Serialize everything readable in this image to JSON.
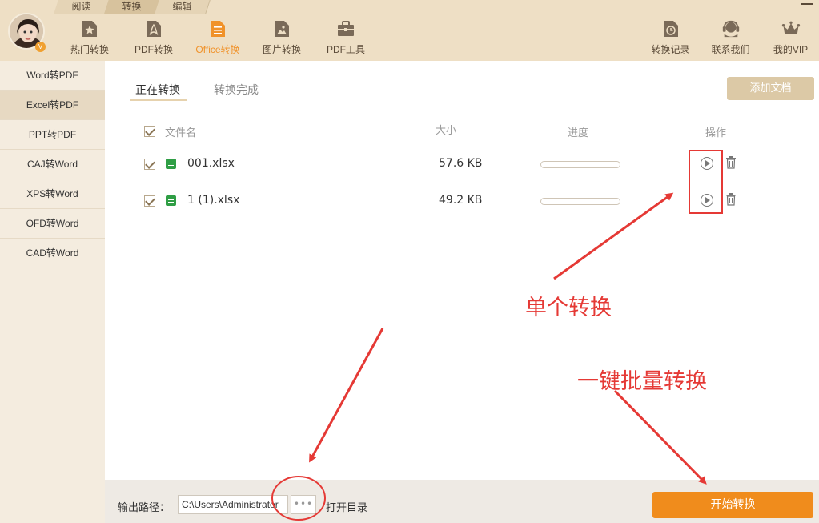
{
  "header": {
    "modes": [
      "阅读",
      "转换",
      "编辑"
    ],
    "active_mode": 1,
    "nav": [
      {
        "label": "热门转换",
        "icon": "star-doc-icon"
      },
      {
        "label": "PDF转换",
        "icon": "pdf-icon"
      },
      {
        "label": "Office转换",
        "icon": "office-doc-icon"
      },
      {
        "label": "图片转换",
        "icon": "image-icon"
      },
      {
        "label": "PDF工具",
        "icon": "toolbox-icon"
      }
    ],
    "active_nav": 2,
    "right_nav": [
      {
        "label": "转换记录",
        "icon": "clock-doc-icon"
      },
      {
        "label": "联系我们",
        "icon": "headset-icon"
      },
      {
        "label": "我的VIP",
        "icon": "crown-icon"
      }
    ],
    "avatar_badge": "V"
  },
  "sidebar": {
    "items": [
      "Word转PDF",
      "Excel转PDF",
      "PPT转PDF",
      "CAJ转Word",
      "XPS转Word",
      "OFD转Word",
      "CAD转Word"
    ],
    "active_index": 1
  },
  "main": {
    "tabs": [
      {
        "label": "正在转换"
      },
      {
        "label": "转换完成"
      }
    ],
    "add_button": "添加文档",
    "columns": {
      "name": "文件名",
      "size": "大小",
      "progress": "进度",
      "action": "操作"
    },
    "files": [
      {
        "name": "001.xlsx",
        "size": "57.6 KB",
        "progress": 0
      },
      {
        "name": "1 (1).xlsx",
        "size": "49.2 KB",
        "progress": 0
      }
    ]
  },
  "bottom": {
    "output_label": "输出路径：",
    "path": "C:\\Users\\Administrator",
    "browse_label": "•••",
    "open_dir": "打开目录",
    "start_button": "开始转换"
  },
  "annotations": {
    "single": "单个转换",
    "batch": "一键批量转换",
    "color": "#e53935"
  },
  "colors": {
    "accent": "#f08c1c",
    "header_bg": "#eedfc5",
    "sidebar_bg": "#f4ecdf"
  }
}
